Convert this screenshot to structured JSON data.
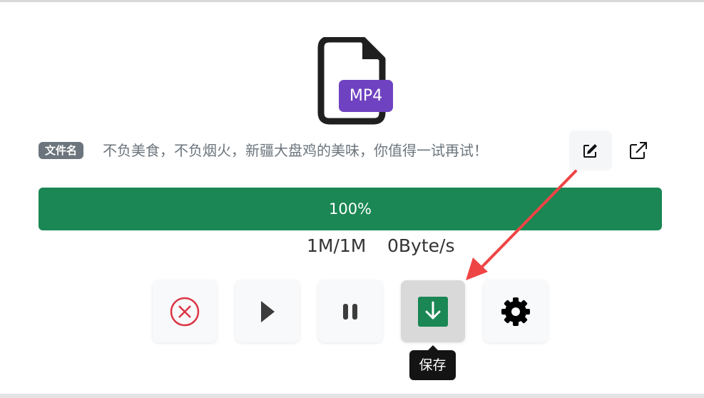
{
  "file": {
    "type_badge": "MP4",
    "name_label": "文件名",
    "name": "不负美食，不负烟火，新疆大盘鸡的美味，你值得一试再试！"
  },
  "progress": {
    "percent_text": "100%",
    "percent": 100,
    "size_text": "1M/1M",
    "speed_text": "0Byte/s"
  },
  "controls": {
    "cancel_icon": "x-circle-icon",
    "play_icon": "play-icon",
    "pause_icon": "pause-icon",
    "save_icon": "download-icon",
    "settings_icon": "gear-icon",
    "tooltip": "保存"
  },
  "colors": {
    "badge_purple": "#6f42c1",
    "progress_green": "#1a8754",
    "cancel_red": "#dc3545",
    "annotation_red": "#ef4444"
  }
}
